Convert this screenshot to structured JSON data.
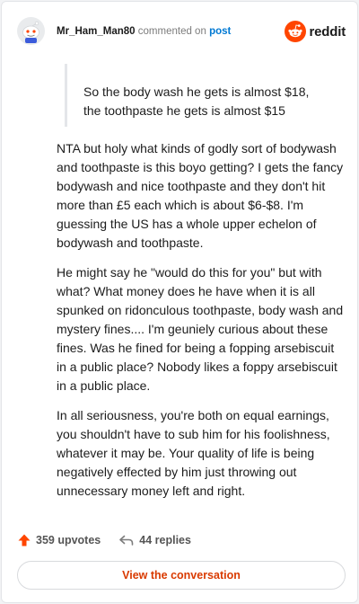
{
  "comment": {
    "username": "Mr_Ham_Man80",
    "commented_text": "commented on",
    "post_link": "post",
    "brand": "reddit",
    "quote": [
      "So the body wash he gets is almost $18,",
      "the toothpaste he gets is almost $15"
    ],
    "paragraphs": [
      "NTA but holy what kinds of godly sort of bodywash and toothpaste is this boyo getting? I gets the fancy bodywash and nice toothpaste and they don't hit more than £5 each which is about $6-$8. I'm guessing the US has a whole upper echelon of bodywash and toothpaste.",
      "He might say he \"would do this for you\" but with what? What money does he have when it is all spunked on ridonculous toothpaste, body wash and mystery fines.... I'm geuniely curious about these fines. Was he fined for being a fopping arsebiscuit in a public place? Nobody likes a foppy arsebiscuit in a public place.",
      "In all seriousness, you're both on equal earnings, you shouldn't have to sub him for his foolishness, whatever it may be. Your quality of life is being negatively effected by him just throwing out unnecessary money left and right."
    ]
  },
  "footer": {
    "upvotes": "359 upvotes",
    "replies": "44 replies",
    "view_button": "View the conversation"
  },
  "colors": {
    "reddit_orange": "#ff4500",
    "link_blue": "#0079d3",
    "button_text": "#d93a00",
    "upvote_arrow": "#ff4500"
  },
  "icons": {
    "avatar": "snoo-avatar",
    "brand": "reddit-logo",
    "upvote": "upvote-arrow-icon",
    "replies": "reply-arrow-icon"
  }
}
